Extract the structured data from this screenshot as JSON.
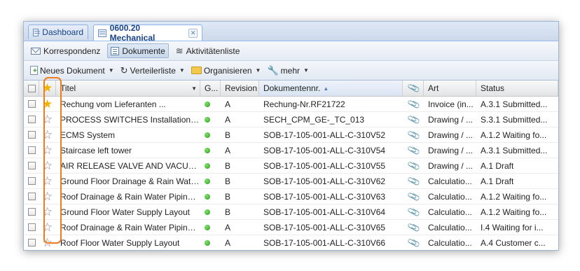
{
  "tabs": [
    {
      "label": "Dashboard",
      "icon": "dashboard-icon"
    },
    {
      "label": "0600.20 Mechanical",
      "icon": "document-icon",
      "close": "✕"
    }
  ],
  "viewbar": {
    "korrespondenz": "Korrespondenz",
    "dokumente": "Dokumente",
    "aktivitaeten": "Aktivitätenliste"
  },
  "actionbar": {
    "neues_dokument": "Neues Dokument",
    "verteilerliste": "Verteilerliste",
    "organisieren": "Organisieren",
    "mehr": "mehr"
  },
  "columns": {
    "titel": "Titel",
    "g": "G...",
    "revision": "Revision",
    "dokumentennr": "Dokumentennr.",
    "art": "Art",
    "status": "Status"
  },
  "highlight_color": "#f07a1c",
  "rows": [
    {
      "starred": true,
      "titel": "Rechung vom Lieferanten ...",
      "rev": "A",
      "nr": "Rechung-Nr.RF21722",
      "art": "Invoice (in...",
      "status": "A.3.1 Submitted..."
    },
    {
      "starred": false,
      "titel": "PROCESS SWITCHES Installation, ...",
      "rev": "A",
      "nr": "SECH_CPM_GE-_TC_013",
      "art": "Drawing / ...",
      "status": "S.3.1 Submitted..."
    },
    {
      "starred": false,
      "titel": "ECMS System",
      "rev": "B",
      "nr": "SOB-17-105-001-ALL-C-310V52",
      "art": "Drawing / ...",
      "status": "A.1.2 Waiting fo..."
    },
    {
      "starred": false,
      "titel": "Staircase left tower",
      "rev": "A",
      "nr": "SOB-17-105-001-ALL-C-310V54",
      "art": "Drawing / ...",
      "status": "A.3.1 Submitted..."
    },
    {
      "starred": false,
      "titel": "AIR RELEASE VALVE AND VACUUM...",
      "rev": "B",
      "nr": "SOB-17-105-001-ALL-C-310V55",
      "art": "Drawing / ...",
      "status": "A.1 Draft"
    },
    {
      "starred": false,
      "titel": "Ground Floor Drainage & Rain Water ...",
      "rev": "B",
      "nr": "SOB-17-105-001-ALL-C-310V62",
      "art": "Calculatio...",
      "status": "A.1 Draft"
    },
    {
      "starred": false,
      "titel": "Roof Drainage & Rain Water Piping L...",
      "rev": "B",
      "nr": "SOB-17-105-001-ALL-C-310V63",
      "art": "Calculatio...",
      "status": "A.1.2 Waiting fo..."
    },
    {
      "starred": false,
      "titel": "Ground Floor Water Supply Layout",
      "rev": "B",
      "nr": "SOB-17-105-001-ALL-C-310V64",
      "art": "Calculatio...",
      "status": "A.1.2 Waiting fo..."
    },
    {
      "starred": false,
      "titel": "Roof Drainage & Rain Water Piping L...",
      "rev": "A",
      "nr": "SOB-17-105-001-ALL-C-310V65",
      "art": "Calculatio...",
      "status": "I.4 Waiting for i..."
    },
    {
      "starred": false,
      "titel": "Roof Floor Water Supply Layout",
      "rev": "A",
      "nr": "SOB-17-105-001-ALL-C-310V66",
      "art": "Calculatio...",
      "status": "A.4 Customer c..."
    }
  ]
}
